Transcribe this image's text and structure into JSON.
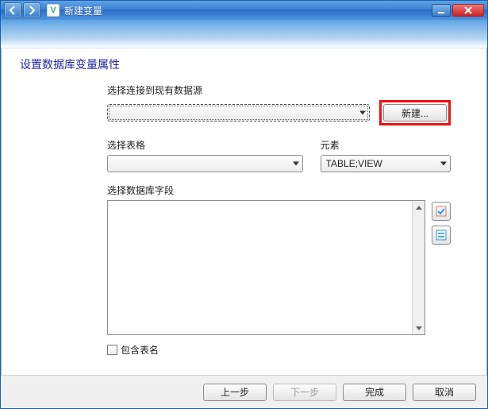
{
  "window": {
    "title": "新建变量"
  },
  "heading": "设置数据库变量属性",
  "labels": {
    "datasource": "选择连接到现有数据源",
    "table": "选择表格",
    "element": "元素",
    "field": "选择数据库字段",
    "include_table_name": "包含表名"
  },
  "buttons": {
    "new": "新建...",
    "back": "上一步",
    "next": "下一步",
    "finish": "完成",
    "cancel": "取消"
  },
  "values": {
    "datasource_selected": "",
    "table_selected": "",
    "element_selected": "TABLE;VIEW"
  }
}
